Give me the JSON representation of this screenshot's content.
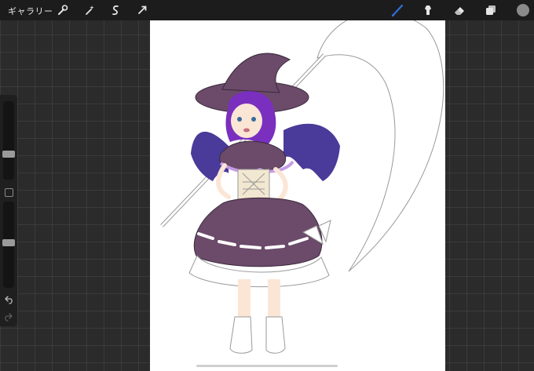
{
  "toolbar": {
    "gallery_label": "ギャラリー",
    "left_tools": [
      "wrench-icon",
      "magic-wand-icon",
      "selection-icon",
      "transform-arrow-icon"
    ],
    "right_tools": [
      "brush-icon",
      "smudge-icon",
      "eraser-icon",
      "layers-icon",
      "color-swatch"
    ],
    "active_tool": "brush-icon",
    "active_color": "#2f6fdc",
    "current_color_swatch": "#8a8a8a"
  },
  "sidebar": {
    "brush_size_level": 0.31,
    "opacity_level": 0.52,
    "buttons": [
      "modifier-square",
      "undo-icon",
      "redo-icon"
    ]
  },
  "artwork": {
    "description_colors": {
      "hat": "#6b4a6a",
      "hair": "#7a2fbf",
      "wings": "#4a3a9a",
      "dress": "#6b4a6a",
      "cape_trim": "#c79be6"
    }
  }
}
